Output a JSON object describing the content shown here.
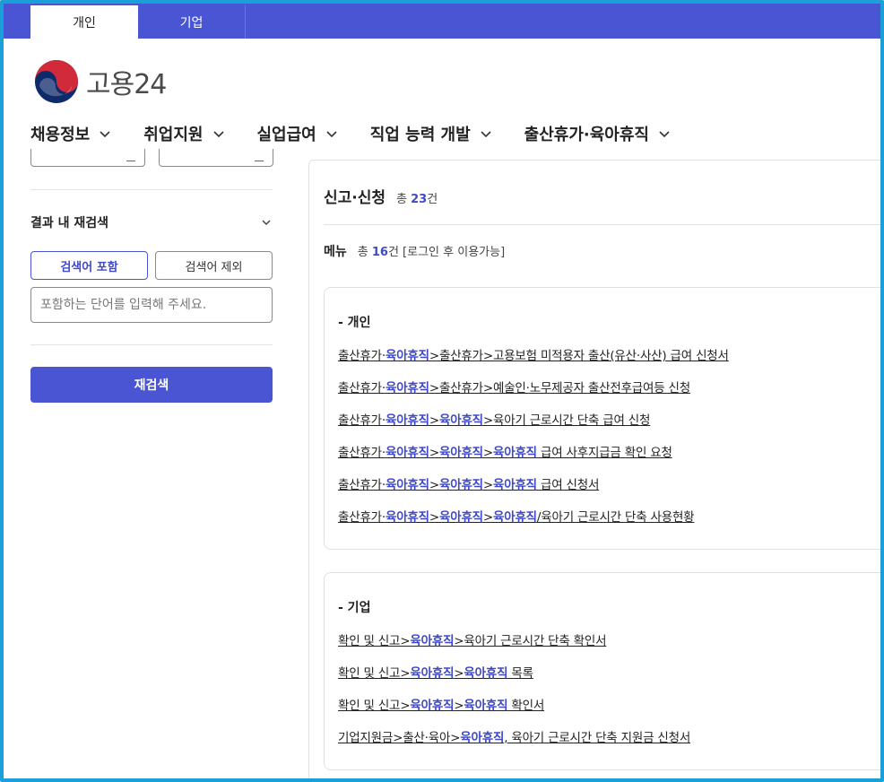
{
  "top_tabs": [
    {
      "label": "개인",
      "active": true
    },
    {
      "label": "기업",
      "active": false
    }
  ],
  "logo": {
    "text": "고용24"
  },
  "gnb": [
    "채용정보",
    "취업지원",
    "실업급여",
    "직업 능력 개발",
    "출산휴가·육아휴직"
  ],
  "filter": {
    "title": "결과 내 재검색",
    "include_label": "검색어 포함",
    "exclude_label": "검색어 제외",
    "input_placeholder": "포함하는 단어를 입력해 주세요.",
    "submit_label": "재검색"
  },
  "results": {
    "section_title": "신고·신청",
    "total_prefix": "총",
    "total_count": "23",
    "total_suffix": "건",
    "menu_title": "메뉴",
    "menu_total_prefix": "총",
    "menu_total_count": "16",
    "menu_total_suffix": "건 [로그인 후 이용가능]"
  },
  "groups": [
    {
      "title": "- 개인",
      "links": [
        [
          [
            "출산휴가·",
            false
          ],
          [
            "육아휴직",
            true
          ],
          [
            ">출산휴가>고용보험 미적용자 출산(유산·사산) 급여 신청서",
            false
          ]
        ],
        [
          [
            "출산휴가·",
            false
          ],
          [
            "육아휴직",
            true
          ],
          [
            ">출산휴가>예술인·노무제공자 출산전후급여등 신청",
            false
          ]
        ],
        [
          [
            "출산휴가·",
            false
          ],
          [
            "육아휴직",
            true
          ],
          [
            ">",
            false
          ],
          [
            "육아휴직",
            true
          ],
          [
            ">육아기 근로시간 단축 급여 신청",
            false
          ]
        ],
        [
          [
            "출산휴가·",
            false
          ],
          [
            "육아휴직",
            true
          ],
          [
            ">",
            false
          ],
          [
            "육아휴직",
            true
          ],
          [
            ">",
            false
          ],
          [
            "육아휴직",
            true
          ],
          [
            " 급여 사후지급금 확인 요청",
            false
          ]
        ],
        [
          [
            "출산휴가·",
            false
          ],
          [
            "육아휴직",
            true
          ],
          [
            ">",
            false
          ],
          [
            "육아휴직",
            true
          ],
          [
            ">",
            false
          ],
          [
            "육아휴직",
            true
          ],
          [
            " 급여 신청서",
            false
          ]
        ],
        [
          [
            "출산휴가·",
            false
          ],
          [
            "육아휴직",
            true
          ],
          [
            ">",
            false
          ],
          [
            "육아휴직",
            true
          ],
          [
            ">",
            false
          ],
          [
            "육아휴직",
            true
          ],
          [
            "/육아기 근로시간 단축 사용현황",
            false
          ]
        ]
      ]
    },
    {
      "title": "- 기업",
      "links": [
        [
          [
            "확인 및 신고>",
            false
          ],
          [
            "육아휴직",
            true
          ],
          [
            ">육아기 근로시간 단축 확인서",
            false
          ]
        ],
        [
          [
            "확인 및 신고>",
            false
          ],
          [
            "육아휴직",
            true
          ],
          [
            ">",
            false
          ],
          [
            "육아휴직",
            true
          ],
          [
            " 목록",
            false
          ]
        ],
        [
          [
            "확인 및 신고>",
            false
          ],
          [
            "육아휴직",
            true
          ],
          [
            ">",
            false
          ],
          [
            "육아휴직",
            true
          ],
          [
            " 확인서",
            false
          ]
        ],
        [
          [
            "기업지원금>출산·육아>",
            false
          ],
          [
            "육아휴직",
            true
          ],
          [
            ", 육아기 근로시간 단축 지원금 신청서",
            false
          ]
        ]
      ]
    }
  ]
}
